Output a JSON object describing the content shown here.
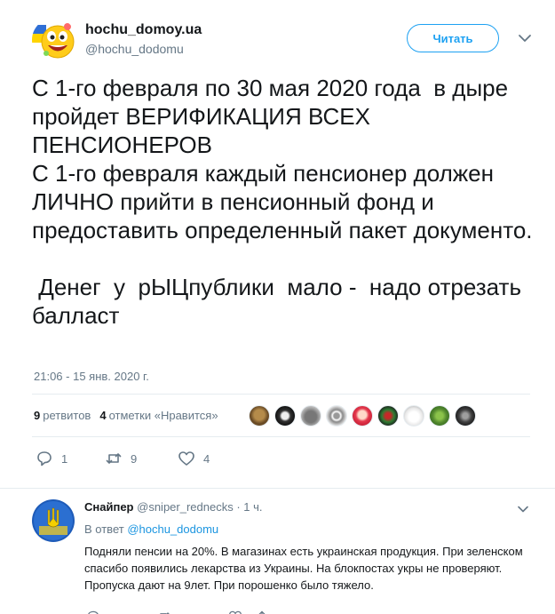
{
  "tweet": {
    "display_name": "hochu_domoy.ua",
    "handle": "@hochu_dodomu",
    "follow_label": "Читать",
    "text": "С 1-го февраля по 30 мая 2020 года  в дыре пройдет ВЕРИФИКАЦИЯ ВСЕХ ПЕНСИОНЕРОВ\nС 1-го февраля каждый пенсионер должен ЛИЧНО прийти в пенсионный фонд и предоставить определенный пакет документо.\n\n Денег  у  рЫЦпублики  мало -  надо отрезать  балласт",
    "timestamp": "21:06 - 15 янв. 2020 г.",
    "stats": {
      "retweets_count": "9",
      "retweets_label": "ретвитов",
      "likes_count": "4",
      "likes_label": "отметки «Нравится»"
    },
    "actions": {
      "reply_count": "1",
      "retweet_count": "9",
      "like_count": "4"
    }
  },
  "reply": {
    "display_name": "Снайпер",
    "handle": "@sniper_rednecks",
    "separator": " · ",
    "time": "1 ч.",
    "reply_to_prefix": "В ответ ",
    "reply_to_handle": "@hochu_dodomu",
    "text": "Подняли пенсии на 20%. В магазинах есть украинская продукция. При зеленском спасибо появились лекарства из Украины. На блокпостах укры не проверяют. Пропуска дают на 9лет. При порошенко было тяжело."
  },
  "colors": {
    "accent": "#1da1f2",
    "link": "#1b95e0",
    "muted": "#657786",
    "text": "#14171a",
    "divider": "#e6ecf0"
  },
  "icons": [
    "smiley-avatar-icon",
    "chevron-down-icon",
    "reply-icon",
    "retweet-icon",
    "heart-icon",
    "ukraine-trident-avatar-icon"
  ]
}
